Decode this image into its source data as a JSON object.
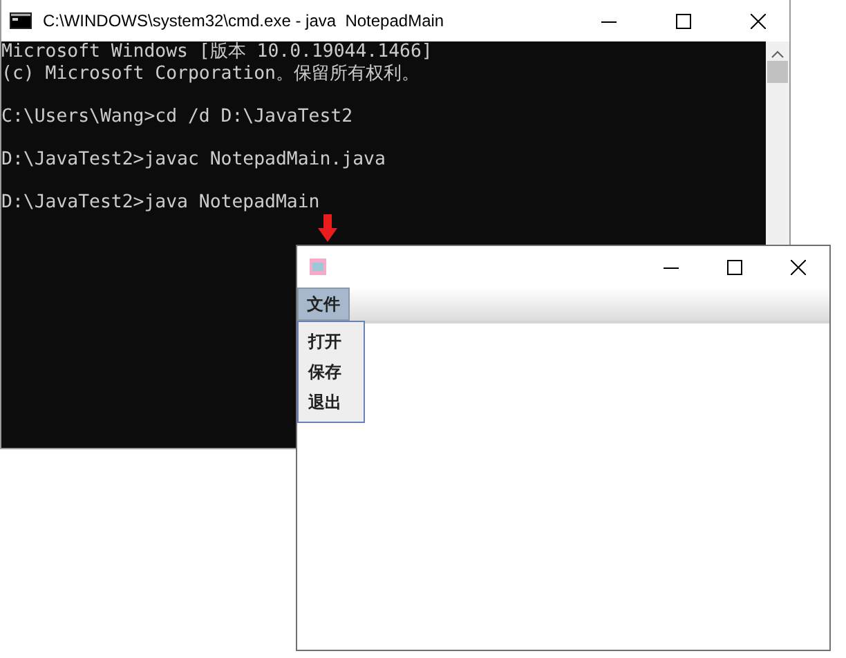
{
  "console_window": {
    "title": "C:\\WINDOWS\\system32\\cmd.exe - java  NotepadMain",
    "blocks": [
      [
        "Microsoft Windows [版本 10.0.19044.1466]",
        "(c) Microsoft Corporation。保留所有权利。"
      ],
      [
        "C:\\Users\\Wang>cd /d D:\\JavaTest2"
      ],
      [
        "D:\\JavaTest2>javac NotepadMain.java"
      ],
      [
        "D:\\JavaTest2>java NotepadMain"
      ]
    ]
  },
  "app_window": {
    "menu_bar": [
      {
        "label": "文件",
        "selected": true,
        "items": [
          "打开",
          "保存",
          "退出"
        ]
      }
    ]
  }
}
